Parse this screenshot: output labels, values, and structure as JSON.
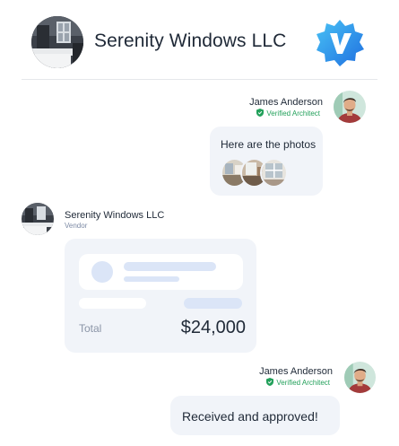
{
  "header": {
    "title": "Serenity Windows LLC",
    "logo_icon": "brand-v-badge-icon",
    "brand_color": "#2f8ef2"
  },
  "messages": [
    {
      "sender": "James Anderson",
      "role": "Verified Architect",
      "side": "right",
      "text": "Here are the photos",
      "attachments": [
        "photo-thumbnail-kitchen",
        "photo-thumbnail-living-room",
        "photo-thumbnail-window"
      ]
    },
    {
      "sender": "Serenity Windows LLC",
      "role": "Vendor",
      "side": "left",
      "quote": {
        "total_label": "Total",
        "total_value": "$24,000"
      }
    },
    {
      "sender": "James Anderson",
      "role": "Verified Architect",
      "side": "right",
      "text": "Received and approved!"
    }
  ],
  "colors": {
    "verified": "#22a05a",
    "bubble": "#f1f4f9",
    "skeleton": "#dbe5f7"
  }
}
